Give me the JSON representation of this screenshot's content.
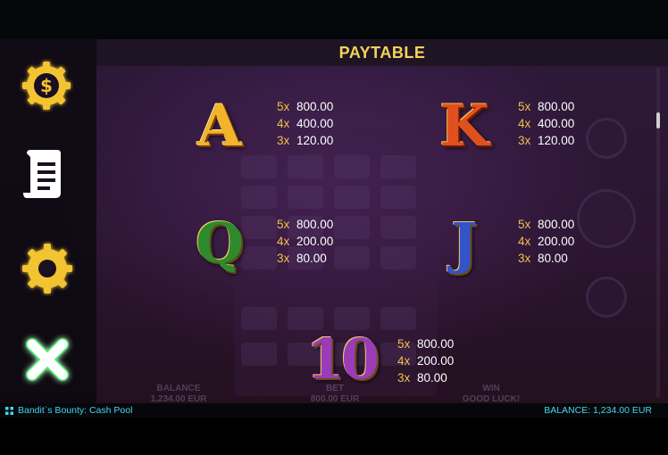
{
  "header": {
    "title": "PAYTABLE"
  },
  "sidebar": {
    "items": [
      {
        "name": "bet-coin-icon"
      },
      {
        "name": "paytable-scroll-icon"
      },
      {
        "name": "settings-gear-icon"
      },
      {
        "name": "close-icon"
      }
    ]
  },
  "paytable": {
    "A": [
      {
        "count": "5x",
        "amount": "800.00"
      },
      {
        "count": "4x",
        "amount": "400.00"
      },
      {
        "count": "3x",
        "amount": "120.00"
      }
    ],
    "K": [
      {
        "count": "5x",
        "amount": "800.00"
      },
      {
        "count": "4x",
        "amount": "400.00"
      },
      {
        "count": "3x",
        "amount": "120.00"
      }
    ],
    "Q": [
      {
        "count": "5x",
        "amount": "800.00"
      },
      {
        "count": "4x",
        "amount": "200.00"
      },
      {
        "count": "3x",
        "amount": "80.00"
      }
    ],
    "J": [
      {
        "count": "5x",
        "amount": "800.00"
      },
      {
        "count": "4x",
        "amount": "200.00"
      },
      {
        "count": "3x",
        "amount": "80.00"
      }
    ],
    "ten": [
      {
        "count": "5x",
        "amount": "800.00"
      },
      {
        "count": "4x",
        "amount": "200.00"
      },
      {
        "count": "3x",
        "amount": "80.00"
      }
    ]
  },
  "symbols": {
    "A": "A",
    "K": "K",
    "Q": "Q",
    "J": "J",
    "ten": "10"
  },
  "background": {
    "balance_label": "BALANCE",
    "balance_value": "1,234.00 EUR",
    "bet_label": "BET",
    "bet_value": "800.00 EUR",
    "win_label": "WIN",
    "win_value": "GOOD LUCK!"
  },
  "footer": {
    "game_name": "Bandit`s Bounty: Cash Pool",
    "balance": "BALANCE: 1,234.00 EUR"
  },
  "colors": {
    "accent_gold": "#f3d35a",
    "footer_text": "#46d6e8",
    "close_green": "#3ef06a"
  }
}
